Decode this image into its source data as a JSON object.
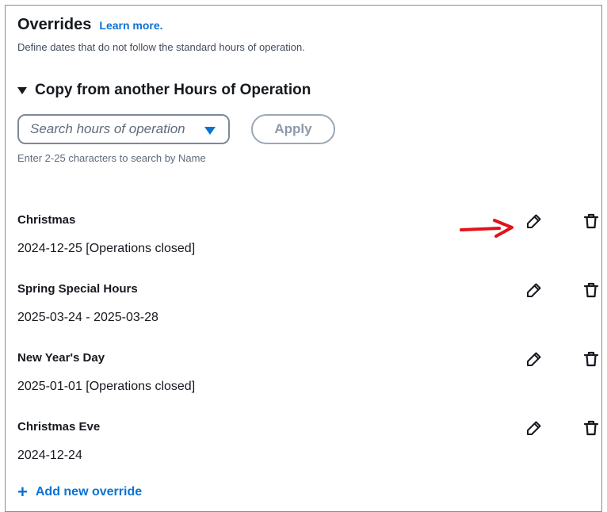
{
  "header": {
    "title": "Overrides",
    "learn_more": "Learn more."
  },
  "description": "Define dates that do not follow the standard hours of operation.",
  "copy_section": {
    "title": "Copy from another Hours of Operation",
    "search_placeholder": "Search hours of operation",
    "apply_label": "Apply",
    "hint": "Enter 2-25 characters to search by Name"
  },
  "overrides": [
    {
      "name": "Christmas",
      "dates": "2024-12-25 [Operations closed]"
    },
    {
      "name": "Spring Special Hours",
      "dates": "2025-03-24 - 2025-03-28"
    },
    {
      "name": "New Year's Day",
      "dates": "2025-01-01 [Operations closed]"
    },
    {
      "name": "Christmas Eve",
      "dates": "2024-12-24"
    }
  ],
  "add_override_label": "Add new override",
  "icons": {
    "edit": "pencil-icon",
    "delete": "trash-icon",
    "expand": "caret-down-icon",
    "dropdown": "caret-down-icon",
    "add": "plus-icon",
    "annotation": "red-arrow-icon"
  },
  "colors": {
    "link": "#0972d3",
    "text": "#16191f",
    "annotation_arrow": "#e0131a"
  }
}
